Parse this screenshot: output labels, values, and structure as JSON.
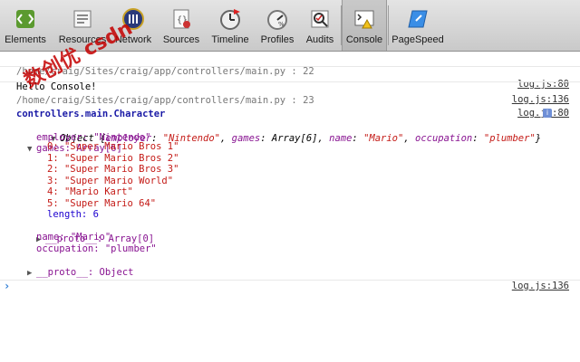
{
  "toolbar": {
    "items": [
      {
        "label": "Elements",
        "icon": "elements-icon"
      },
      {
        "label": "Resources",
        "icon": "resources-icon"
      },
      {
        "label": "Network",
        "icon": "network-icon"
      },
      {
        "label": "Sources",
        "icon": "sources-icon"
      },
      {
        "label": "Timeline",
        "icon": "timeline-icon"
      },
      {
        "label": "Profiles",
        "icon": "profiles-icon"
      },
      {
        "label": "Audits",
        "icon": "audits-icon"
      },
      {
        "label": "Console",
        "icon": "console-icon",
        "selected": true
      },
      {
        "label": "PageSpeed",
        "icon": "pagespeed-icon"
      }
    ]
  },
  "watermark": "数创优 csdn",
  "console": {
    "rows": [
      {
        "text": "/home/craig/Sites/craig/app/controllers/main.py : 22",
        "source": "log.js:80"
      },
      {
        "text": "Hello Console!",
        "source": "log.js:136"
      },
      {
        "text": "/home/craig/Sites/craig/app/controllers/main.py : 23",
        "source": "log.js:80"
      },
      {
        "text": "controllers.main.Character"
      },
      {
        "object_summary": {
          "prefix": "Object {",
          "pairs": [
            {
              "key": "employer",
              "value": "\"Nintendo\""
            },
            {
              "key": "games",
              "value": "Array[6]"
            },
            {
              "key": "name",
              "value": "\"Mario\""
            },
            {
              "key": "occupation",
              "value": "\"plumber\""
            }
          ],
          "suffix": "}"
        }
      },
      {
        "text": "employer: \"Nintendo\""
      },
      {
        "text": "games: Array[6]"
      },
      {
        "text": "0: \"Super Mario Bros 1\""
      },
      {
        "text": "1: \"Super Mario Bros 2\""
      },
      {
        "text": "2: \"Super Mario Bros 3\""
      },
      {
        "text": "3: \"Super Mario World\""
      },
      {
        "text": "4: \"Mario Kart\""
      },
      {
        "text": "5: \"Super Mario 64\""
      },
      {
        "text": "length: 6"
      },
      {
        "text": "__proto__: Array[0]"
      },
      {
        "text": "name: \"Mario\""
      },
      {
        "text": "occupation: \"plumber\""
      },
      {
        "text": "__proto__: Object"
      },
      {
        "source": "log.js:136"
      }
    ],
    "prompt": "›"
  },
  "colors": {
    "prop": "#881391",
    "string": "#c41a16",
    "number": "#1c00cf",
    "link": "#333333",
    "prompt": "#2b7bd4"
  }
}
